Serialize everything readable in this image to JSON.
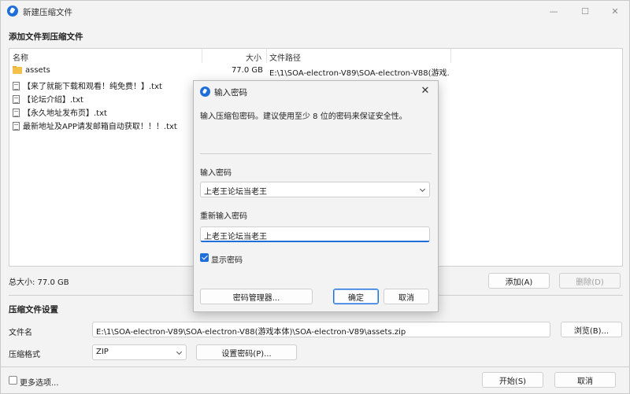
{
  "window": {
    "title": "新建压缩文件",
    "controls": {
      "minimize": "—",
      "maximize": "☐",
      "close": "✕"
    }
  },
  "add_section": {
    "heading": "添加文件到压缩文件"
  },
  "file_list": {
    "columns": [
      "名称",
      "大小",
      "文件路径"
    ],
    "rows": [
      {
        "name": "assets",
        "icon": "folder-icon",
        "size": "77.0 GB",
        "path": "E:\\1\\SOA-electron-V89\\SOA-electron-V88(游戏..."
      },
      {
        "name": "【来了就能下载和观看！纯免费！】.txt",
        "icon": "text-file-icon",
        "size": "",
        "path": ""
      },
      {
        "name": "【论坛介绍】.txt",
        "icon": "text-file-icon",
        "size": "",
        "path": ""
      },
      {
        "name": "【永久地址发布页】.txt",
        "icon": "text-file-icon",
        "size": "",
        "path": ""
      },
      {
        "name": "最新地址及APP请发邮箱自动获取！！！.txt",
        "icon": "text-file-icon",
        "size": "",
        "path": ""
      }
    ]
  },
  "total": {
    "label": "总大小: 77.0 GB"
  },
  "list_buttons": {
    "add": "添加(A)",
    "delete": "删除(D)"
  },
  "settings": {
    "heading": "压缩文件设置",
    "filename_label": "文件名",
    "filename_value": "E:\\1\\SOA-electron-V89\\SOA-electron-V88(游戏本体)\\SOA-electron-V89\\assets.zip",
    "browse": "浏览(B)...",
    "format_label": "压缩格式",
    "format_value": "ZIP",
    "set_password": "设置密码(P)..."
  },
  "footer": {
    "more_options": "更多选项...",
    "start": "开始(S)",
    "cancel": "取消"
  },
  "password_dialog": {
    "title": "输入密码",
    "description": "输入压缩包密码。建议使用至少 8 位的密码来保证安全性。",
    "enter_label": "输入密码",
    "enter_value": "上老王论坛当老王",
    "reenter_label": "重新输入密码",
    "reenter_value": "上老王论坛当老王",
    "show_password": "显示密码",
    "show_password_checked": true,
    "manager": "密码管理器...",
    "ok": "确定",
    "cancel": "取消",
    "close": "✕"
  },
  "colors": {
    "accent": "#1e6fd9",
    "folder": "#f4c24a"
  }
}
